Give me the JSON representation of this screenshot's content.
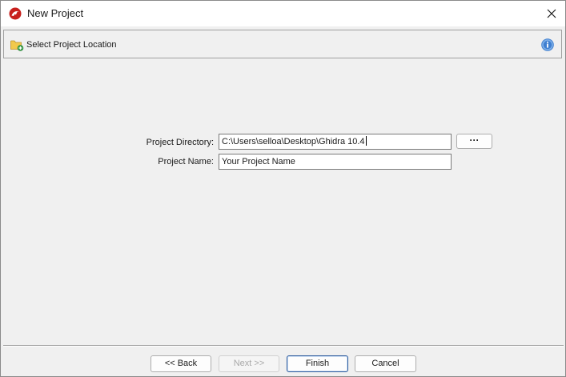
{
  "window": {
    "title": "New Project"
  },
  "header": {
    "label": "Select Project Location"
  },
  "form": {
    "directory_label": "Project Directory:",
    "directory_value": "C:\\Users\\selloa\\Desktop\\Ghidra 10.4",
    "name_label": "Project Name:",
    "name_value": "Your Project Name",
    "browse_label": "···"
  },
  "buttons": {
    "back": "<< Back",
    "next": "Next >>",
    "finish": "Finish",
    "cancel": "Cancel"
  },
  "colors": {
    "accent": "#2c5a9c",
    "window_bg": "#f0f0f0",
    "info_blue": "#3f7fd0",
    "folder_yellow": "#f2c94c",
    "logo_red": "#c8201d"
  }
}
